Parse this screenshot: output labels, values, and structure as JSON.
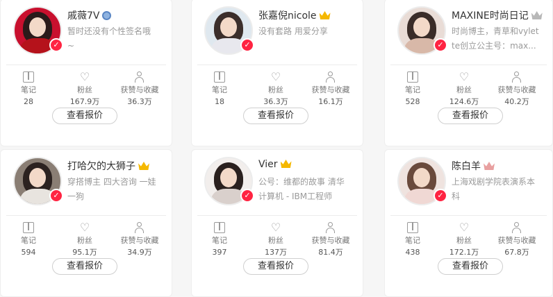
{
  "stat_labels": {
    "notes": "笔记",
    "fans": "粉丝",
    "likes": "获赞与收藏"
  },
  "button_label": "查看报价",
  "cards": [
    {
      "name": "戚薇7V",
      "bio": "暂时还没有个性签名哦~",
      "notes": "28",
      "fans": "167.9万",
      "likes": "36.3万",
      "badge": "scope-icon",
      "colors": {
        "bg": "#c8102e",
        "hair": "#2a1a1a",
        "body": "#b5121b"
      }
    },
    {
      "name": "张嘉倪nicole",
      "bio": "没有套路 用爱分享",
      "notes": "18",
      "fans": "36.3万",
      "likes": "16.1万",
      "badge": "gold-crown-icon",
      "colors": {
        "bg": "#dfe8ef",
        "hair": "#3b2e2b",
        "body": "#e8e8ee"
      }
    },
    {
      "name": "MAXINE时尚日记",
      "bio": "时尚博主，青草和vylette创立公主号：max...",
      "notes": "528",
      "fans": "124.6万",
      "likes": "40.2万",
      "badge": "silver-crown-icon",
      "colors": {
        "bg": "#e9dcd6",
        "hair": "#3a2c28",
        "body": "#d8b8a8"
      }
    },
    {
      "name": "打哈欠的大狮子",
      "bio": "穿搭博主 四大咨询 一娃一狗",
      "notes": "594",
      "fans": "95.1万",
      "likes": "34.9万",
      "badge": "gold-crown-icon",
      "colors": {
        "bg": "#8a7e74",
        "hair": "#2c2220",
        "body": "#e8e4df"
      }
    },
    {
      "name": "Vier",
      "bio": "公号：维都的故事 清华计算机 - IBM工程师",
      "notes": "397",
      "fans": "137万",
      "likes": "81.4万",
      "badge": "gold-crown-icon",
      "colors": {
        "bg": "#f2eeec",
        "hair": "#2a201e",
        "body": "#d9d0cc"
      }
    },
    {
      "name": "陈白羊",
      "bio": "上海戏剧学院表演系本科",
      "notes": "438",
      "fans": "172.1万",
      "likes": "67.8万",
      "badge": "pink-crown-icon",
      "colors": {
        "bg": "#efe3df",
        "hair": "#6a4a3c",
        "body": "#f0d8d4"
      }
    }
  ]
}
